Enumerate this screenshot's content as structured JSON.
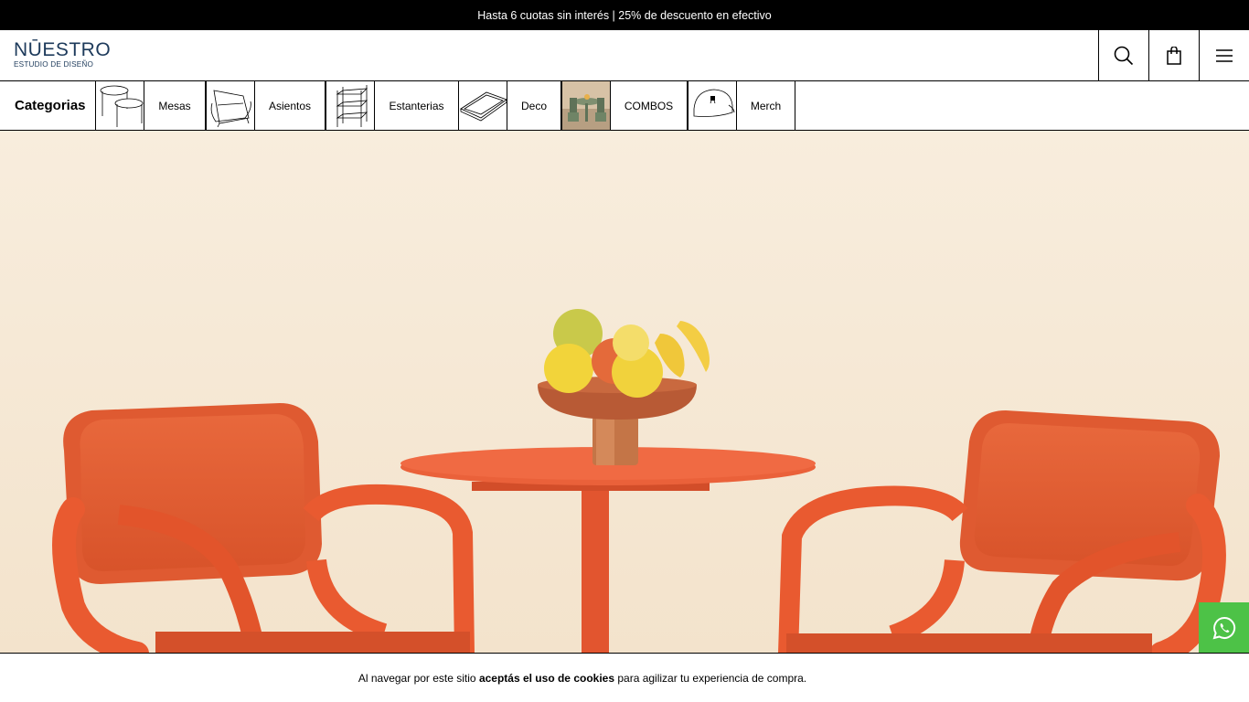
{
  "promo": {
    "text": "Hasta 6 cuotas sin interés | 25% de descuento en efectivo"
  },
  "header": {
    "logo_main": "NŪESTRO",
    "logo_sub": "ESTUDIO DE DISEÑO",
    "icons": [
      "search-icon",
      "bag-icon",
      "menu-icon"
    ]
  },
  "categories": {
    "title": "Categorias",
    "items": [
      {
        "label": "Mesas",
        "icon": "tables-thumbnail"
      },
      {
        "label": "Asientos",
        "icon": "chair-thumbnail"
      },
      {
        "label": "Estanterias",
        "icon": "shelf-thumbnail"
      },
      {
        "label": "Deco",
        "icon": "tray-thumbnail"
      },
      {
        "label": "COMBOS",
        "icon": "combo-photo-thumbnail"
      },
      {
        "label": "Merch",
        "icon": "cap-thumbnail"
      }
    ]
  },
  "cookie": {
    "prefix": "Al navegar por este sitio ",
    "bold": "aceptás el uso de cookies",
    "suffix": " para agilizar tu experiencia de compra."
  },
  "colors": {
    "furniture": "#e4572e",
    "whatsapp": "#4dc247",
    "logo": "#1d3a5b"
  }
}
